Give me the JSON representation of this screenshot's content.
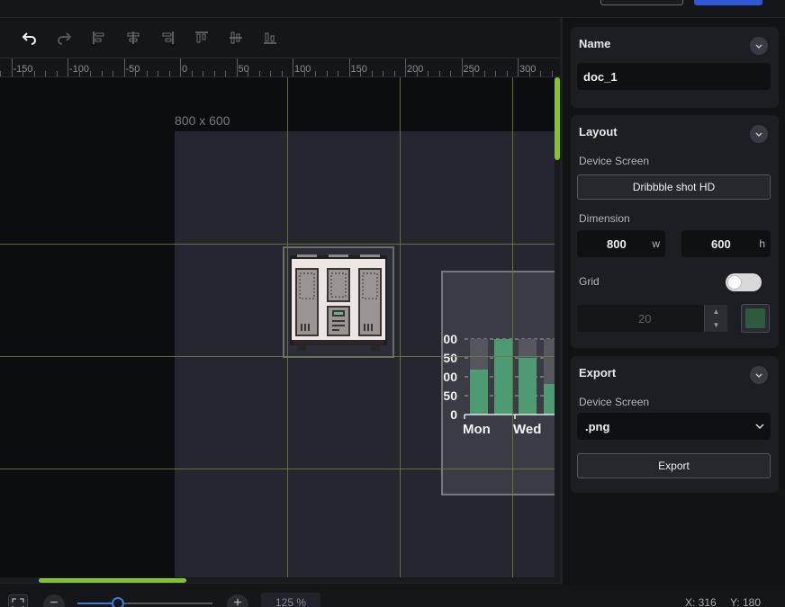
{
  "ruler": {
    "numbers": [
      "-150",
      "-100",
      "-50",
      "0",
      "50",
      "100",
      "150",
      "200",
      "250",
      "300"
    ],
    "guides": [
      "100",
      "200",
      "300"
    ]
  },
  "canvas": {
    "page_size": "800 x 600",
    "chart": {
      "y_ticks": [
        "00",
        "50",
        "00",
        "50",
        "0"
      ],
      "x_labels": [
        "Mon",
        "Wed"
      ]
    }
  },
  "status": {
    "zoom": "125 %",
    "zoom_fraction": 0.3,
    "x": "X: 316",
    "y": "Y: 180",
    "zoom_out": "−",
    "zoom_in": "+"
  },
  "panel": {
    "name": {
      "title": "Name",
      "value": "doc_1"
    },
    "layout": {
      "title": "Layout",
      "device_label": "Device Screen",
      "device_button": "Dribbble shot HD",
      "dimension_label": "Dimension",
      "width": "800",
      "width_unit": "w",
      "height": "600",
      "height_unit": "h",
      "grid_label": "Grid",
      "grid_on": false,
      "grid_size": "20",
      "grid_color": "#2e5a40"
    },
    "export": {
      "title": "Export",
      "device_label": "Device Screen",
      "format": ".png",
      "button": "Export"
    }
  },
  "colors": {
    "accent_green": "#84c23a",
    "guide_green": "#6d7c3b",
    "primary_blue": "#2f57d6",
    "bar_green": "#4e9a72"
  },
  "icons": [
    "undo-icon",
    "redo-icon",
    "align-left-icon",
    "align-center-h-icon",
    "align-right-icon",
    "align-top-icon",
    "align-center-v-icon",
    "align-bottom-icon",
    "fit-screen-icon",
    "chevron-up-icon",
    "chevron-down-icon"
  ]
}
